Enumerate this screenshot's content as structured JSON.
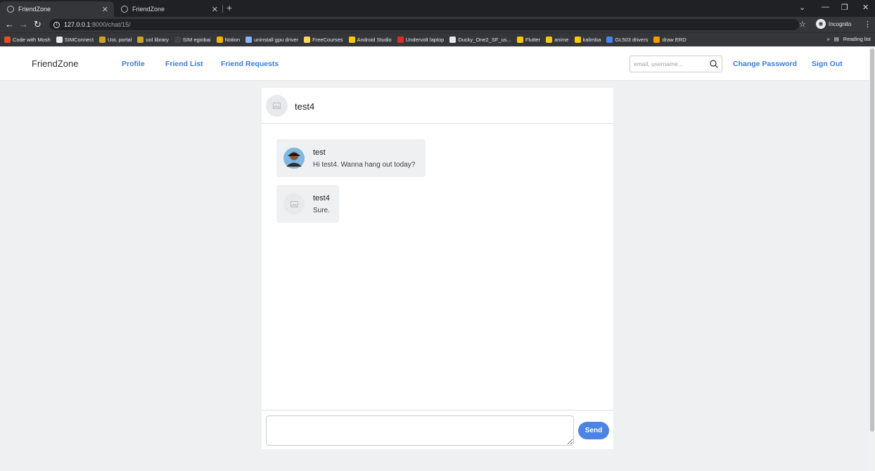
{
  "browser": {
    "tabs": [
      {
        "title": "FriendZone",
        "active": true
      },
      {
        "title": "FriendZone",
        "active": false
      }
    ],
    "new_tab": "+",
    "url_host": "127.0.0.1",
    "url_path": ":8000/chat/15/",
    "incognito_label": "Incognito",
    "bookmarks": [
      {
        "label": "Code with Mosh",
        "color": "#e44d26"
      },
      {
        "label": "SIMConnect",
        "color": "#e8eaed"
      },
      {
        "label": "UoL portal",
        "color": "#c9a227"
      },
      {
        "label": "uol library",
        "color": "#c9a227"
      },
      {
        "label": "SIM egiobai",
        "color": "#444444"
      },
      {
        "label": "Notion",
        "color": "#f4b400"
      },
      {
        "label": "uninstall gpu driver",
        "color": "#8ab4f8"
      },
      {
        "label": "FreeCourses",
        "color": "#f9d65c"
      },
      {
        "label": "Android Studio",
        "color": "#f9c80e"
      },
      {
        "label": "Undervolt laptop",
        "color": "#d93025"
      },
      {
        "label": "Ducky_One2_SF_us...",
        "color": "#e8eaed"
      },
      {
        "label": "Flutter",
        "color": "#f9c80e"
      },
      {
        "label": "anime",
        "color": "#f9c80e"
      },
      {
        "label": "kalimba",
        "color": "#f9c80e"
      },
      {
        "label": "GL503 drivers",
        "color": "#4285f4"
      },
      {
        "label": "draw ERD",
        "color": "#f29900"
      }
    ],
    "more_bookmarks": "»",
    "reading_list": "Reading list"
  },
  "navbar": {
    "brand": "FriendZone",
    "links": {
      "profile": "Profile",
      "friend_list": "Friend List",
      "friend_requests": "Friend Requests"
    },
    "search_placeholder": "email, username...",
    "change_password": "Change Password",
    "sign_out": "Sign Out"
  },
  "chat": {
    "partner_name": "test4",
    "messages": [
      {
        "author": "test",
        "text": "Hi test4. Wanna hang out today?",
        "has_photo": true
      },
      {
        "author": "test4",
        "text": "Sure.",
        "has_photo": false
      }
    ],
    "message_value": "",
    "send_label": "Send"
  },
  "colors": {
    "accent": "#3b7ddd",
    "send_button": "#4c84e6",
    "page_background": "#eef0f1",
    "message_bubble": "#eff0f2"
  }
}
